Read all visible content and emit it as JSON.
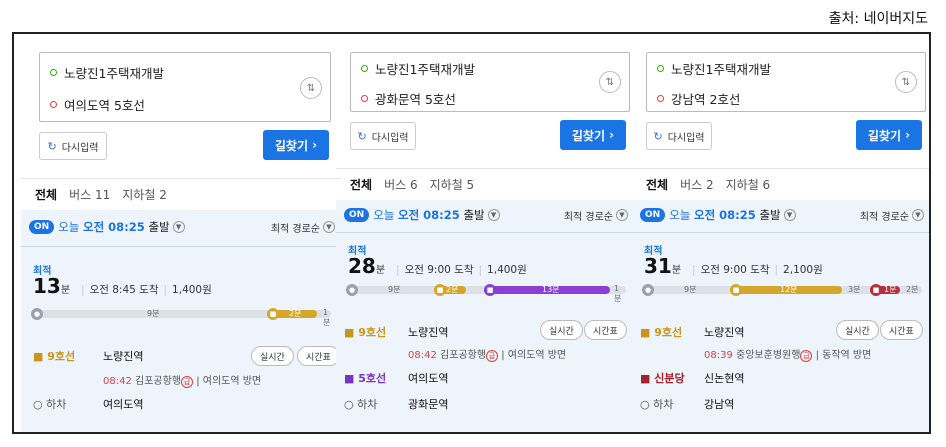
{
  "source": "출처: 네이버지도",
  "panels": [
    {
      "origin": "노량진1주택재개발",
      "dest": "여의도역 5호선",
      "retry": "다시입력",
      "go": "길찾기",
      "tabs": [
        "전체",
        "버스 11",
        "지하철 2"
      ],
      "on": "ON",
      "today": "오늘",
      "time": "오전 08:25",
      "depart": "출발",
      "sort": "최적 경로순",
      "best": "최적",
      "minutes": "13",
      "unit": "분",
      "arrive": "오전 8:45 도착",
      "fare": "1,400원",
      "tl": {
        "walk1": "9분",
        "ride": "2분",
        "walk2": "1분"
      },
      "steps": [
        {
          "line": "9호선",
          "station": "노량진역",
          "sub_time": "08:42",
          "sub_dir": "김포공항행",
          "sub_exit": "여의도역 방면",
          "btn1": "실시간",
          "btn2": "시간표",
          "badge": "급"
        },
        {
          "line": "하차",
          "station": "여의도역"
        }
      ]
    },
    {
      "origin": "노량진1주택재개발",
      "dest": "광화문역 5호선",
      "retry": "다시입력",
      "go": "길찾기",
      "tabs": [
        "전체",
        "버스 6",
        "지하철 5"
      ],
      "on": "ON",
      "today": "오늘",
      "time": "오전 08:25",
      "depart": "출발",
      "sort": "최적 경로순",
      "best": "최적",
      "minutes": "28",
      "unit": "분",
      "arrive": "오전 9:00 도착",
      "fare": "1,400원",
      "tl": {
        "walk1": "9분",
        "ride1": "2분",
        "ride2": "13분",
        "walk2": "1분"
      },
      "steps": [
        {
          "line": "9호선",
          "station": "노량진역",
          "sub_time": "08:42",
          "sub_dir": "김포공항행",
          "sub_exit": "여의도역 방면",
          "btn1": "실시간",
          "btn2": "시간표",
          "badge": "급"
        },
        {
          "line": "5호선",
          "station": "여의도역"
        },
        {
          "line": "하차",
          "station": "광화문역"
        }
      ]
    },
    {
      "origin": "노량진1주택재개발",
      "dest": "강남역 2호선",
      "retry": "다시입력",
      "go": "길찾기",
      "tabs": [
        "전체",
        "버스 2",
        "지하철 6"
      ],
      "on": "ON",
      "today": "오늘",
      "time": "오전 08:25",
      "depart": "출발",
      "sort": "최적 경로순",
      "best": "최적",
      "minutes": "31",
      "unit": "분",
      "arrive": "오전 9:00 도착",
      "fare": "2,100원",
      "tl": {
        "walk1": "9분",
        "ride1": "12분",
        "walk2": "3분",
        "ride2": "1분",
        "walk3": "2분"
      },
      "steps": [
        {
          "line": "9호선",
          "station": "노량진역",
          "sub_time": "08:39",
          "sub_dir": "중앙보훈병원행",
          "sub_exit": "동작역 방면",
          "btn1": "실시간",
          "btn2": "시간표",
          "badge": "급"
        },
        {
          "line": "신분당",
          "station": "신논현역"
        },
        {
          "line": "하차",
          "station": "강남역"
        }
      ]
    }
  ]
}
